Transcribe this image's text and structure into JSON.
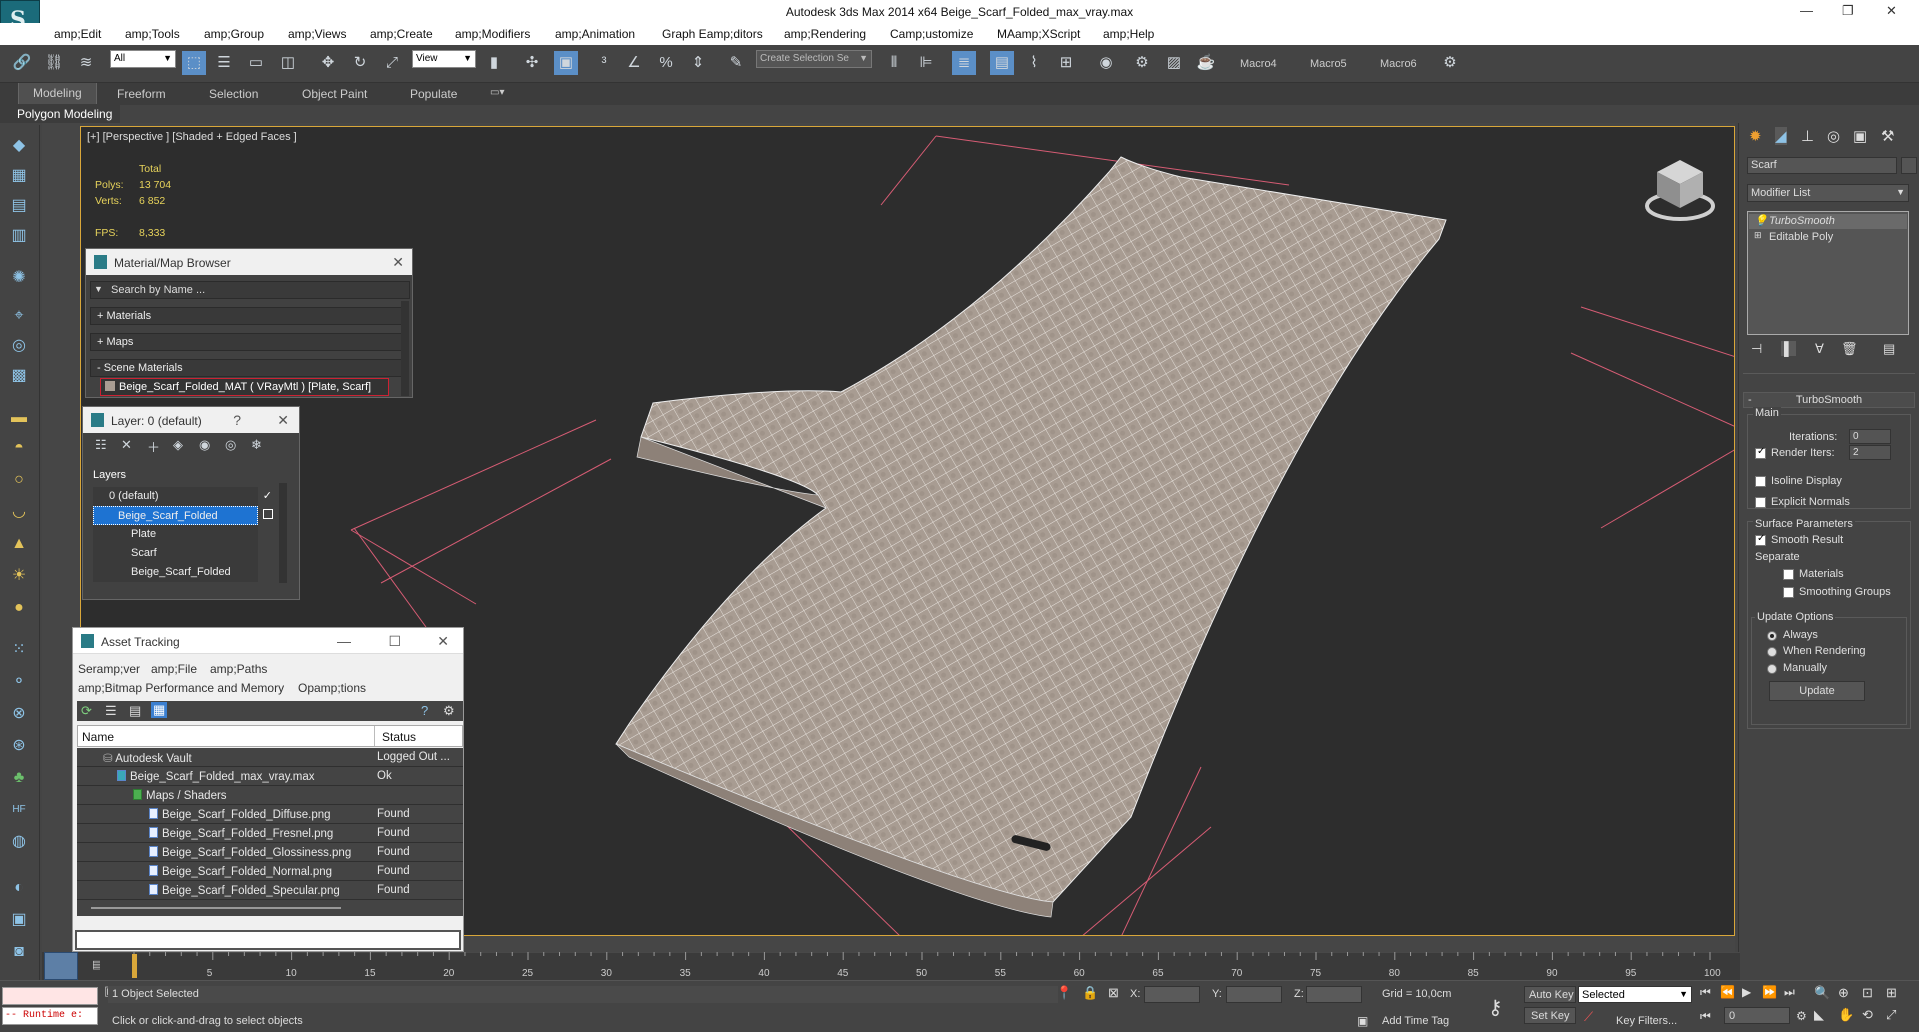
{
  "window": {
    "title": "Autodesk 3ds Max  2014 x64     Beige_Scarf_Folded_max_vray.max"
  },
  "menu": [
    "amp;Edit",
    "amp;Tools",
    "amp;Group",
    "amp;Views",
    "amp;Create",
    "amp;Modifiers",
    "amp;Animation",
    "Graph Eamp;ditors",
    "amp;Rendering",
    "Camp;ustomize",
    "MAamp;XScript",
    "amp;Help"
  ],
  "toolbar": {
    "selection_filter": "All",
    "ref_coord": "View",
    "named_selection": "Create Selection Se",
    "macros": [
      "Macro4",
      "Macro5",
      "Macro6"
    ]
  },
  "ribbon": {
    "tabs": [
      "Modeling",
      "Freeform",
      "Selection",
      "Object Paint",
      "Populate"
    ],
    "active": "Modeling",
    "panel": "Polygon Modeling"
  },
  "viewport": {
    "label": "[+] [Perspective ] [Shaded + Edged Faces ]",
    "stats": {
      "total_label": "Total",
      "polys_label": "Polys:",
      "polys": "13 704",
      "verts_label": "Verts:",
      "verts": "6 852",
      "fps_label": "FPS:",
      "fps": "8,333"
    }
  },
  "material_browser": {
    "title": "Material/Map Browser",
    "search_placeholder": "Search by Name ...",
    "sections": [
      "+ Materials",
      "+ Maps",
      "- Scene Materials"
    ],
    "selected_material": "Beige_Scarf_Folded_MAT  ( VRayMtl )  [Plate, Scarf]"
  },
  "layer_window": {
    "title": "Layer: 0 (default)",
    "help": "?",
    "header": "Layers",
    "rows": [
      "0 (default)",
      "Beige_Scarf_Folded",
      "Plate",
      "Scarf",
      "Beige_Scarf_Folded"
    ]
  },
  "asset_tracking": {
    "title": "Asset Tracking",
    "menu1": [
      "Seramp;ver",
      "amp;File",
      "amp;Paths"
    ],
    "menu2": [
      "amp;Bitmap Performance and Memory",
      "Opamp;tions"
    ],
    "columns": [
      "Name",
      "Status"
    ],
    "rows": [
      {
        "name": "Autodesk Vault",
        "status": "Logged Out ..."
      },
      {
        "name": "Beige_Scarf_Folded_max_vray.max",
        "status": "Ok"
      },
      {
        "name": "Maps / Shaders",
        "status": ""
      },
      {
        "name": "Beige_Scarf_Folded_Diffuse.png",
        "status": "Found"
      },
      {
        "name": "Beige_Scarf_Folded_Fresnel.png",
        "status": "Found"
      },
      {
        "name": "Beige_Scarf_Folded_Glossiness.png",
        "status": "Found"
      },
      {
        "name": "Beige_Scarf_Folded_Normal.png",
        "status": "Found"
      },
      {
        "name": "Beige_Scarf_Folded_Specular.png",
        "status": "Found"
      }
    ]
  },
  "command_panel": {
    "object_name": "Scarf",
    "modifier_list": "Modifier List",
    "stack": [
      "TurboSmooth",
      "Editable Poly"
    ],
    "rollout_title": "TurboSmooth",
    "main_label": "Main",
    "iterations_label": "Iterations:",
    "iterations": "0",
    "render_iters_label": "Render Iters:",
    "render_iters": "2",
    "isoline": "Isoline Display",
    "explicit_normals": "Explicit Normals",
    "surface_params": "Surface Parameters",
    "smooth_result": "Smooth Result",
    "separate": "Separate",
    "materials": "Materials",
    "smoothing_groups": "Smoothing Groups",
    "update_options": "Update Options",
    "always": "Always",
    "when_rendering": "When Rendering",
    "manually": "Manually",
    "update_button": "Update"
  },
  "timeline": {
    "position": "0 / 100",
    "ticks": [
      "5",
      "10",
      "15",
      "20",
      "25",
      "30",
      "35",
      "40",
      "45",
      "50",
      "55",
      "60",
      "65",
      "70",
      "75",
      "80",
      "85",
      "90",
      "95",
      "100"
    ]
  },
  "status": {
    "script_text": "-- Runtime e:",
    "selected": "1 Object Selected",
    "prompt": "Click or click-and-drag to select objects",
    "x_label": "X:",
    "y_label": "Y:",
    "z_label": "Z:",
    "grid": "Grid = 10,0cm",
    "add_time_tag": "Add Time Tag",
    "auto_key": "Auto Key",
    "set_key": "Set Key",
    "key_mode": "Selected",
    "key_filters": "Key Filters...",
    "frame": "0"
  },
  "colors": {
    "accent": "#d9a73a",
    "selection_blue": "#1e73d2",
    "viewport_bg": "#2d2d2d",
    "mesh_fill": "#a89c92"
  }
}
